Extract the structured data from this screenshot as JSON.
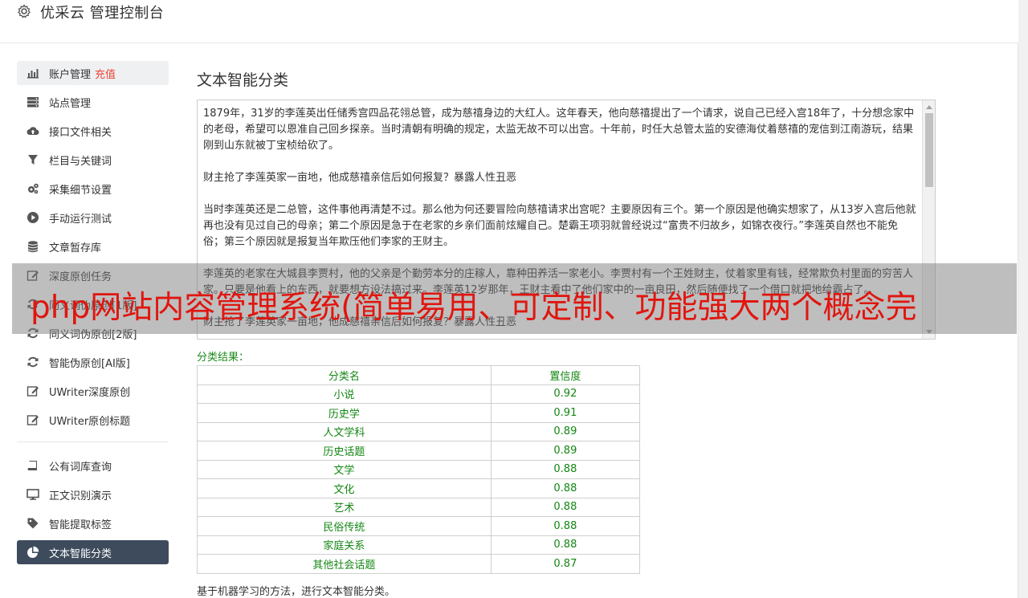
{
  "app": {
    "title": "优采云 管理控制台"
  },
  "sidebar": {
    "account": {
      "label": "账户管理",
      "recharge": "充值"
    },
    "items_group1": [
      {
        "label": "站点管理",
        "icon": "server-icon"
      },
      {
        "label": "接口文件相关",
        "icon": "cloud-upload-icon"
      },
      {
        "label": "栏目与关键词",
        "icon": "filter-icon"
      },
      {
        "label": "采集细节设置",
        "icon": "gears-icon"
      },
      {
        "label": "手动运行测试",
        "icon": "play-icon"
      },
      {
        "label": "文章暂存库",
        "icon": "database-icon"
      },
      {
        "label": "深度原创任务",
        "icon": "edit-icon"
      },
      {
        "label": "同义词伪原创[1版]",
        "icon": "refresh-icon"
      },
      {
        "label": "同义词伪原创[2版]",
        "icon": "refresh-icon"
      },
      {
        "label": "智能伪原创[AI版]",
        "icon": "refresh-icon"
      },
      {
        "label": "UWriter深度原创",
        "icon": "edit-icon"
      },
      {
        "label": "UWriter原创标题",
        "icon": "edit-icon"
      }
    ],
    "items_group2": [
      {
        "label": "公有词库查询",
        "icon": "book-icon"
      },
      {
        "label": "正文识别演示",
        "icon": "monitor-icon"
      },
      {
        "label": "智能提取标签",
        "icon": "tag-icon"
      },
      {
        "label": "文本智能分类",
        "icon": "pie-chart-icon"
      }
    ]
  },
  "main": {
    "title": "文本智能分类",
    "text_paragraphs": [
      "1879年，31岁的李莲英出任储秀宫四品花翎总管，成为慈禧身边的大红人。这年春天，他向慈禧提出了一个请求，说自己已经入宫18年了，十分想念家中的老母，希望可以恩准自己回乡探亲。当时清朝有明确的规定，太监无故不可以出宫。十年前，时任大总管太监的安德海仗着慈禧的宠信到江南游玩，结果刚到山东就被丁宝桢给砍了。",
      "财主抢了李莲英家一亩地，他成慈禧亲信后如何报复？暴露人性丑恶",
      "当时李莲英还是二总管，这件事他再清楚不过。那么他为何还要冒险向慈禧请求出宫呢？主要原因有三个。第一个原因是他确实想家了，从13岁入宫后他就再也没有见过自己的母亲；第二个原因是急于在老家的乡亲们面前炫耀自己。楚霸王项羽就曾经说过“富贵不归故乡，如锦衣夜行。”李莲英自然也不能免俗；第三个原因就是报复当年欺压他们李家的王财主。",
      "李莲英的老家在大城县李贾村，他的父亲是个勤劳本分的庄稼人，靠种田养活一家老小。李贾村有一个王姓财主，仗着家里有钱，经常欺负村里面的穷苦人家。只要是他看上的东西，就要想方设法搞过来。李莲英12岁那年，王财主看中了他们家中的一亩良田，然后随便找了一个借口就把地给霸占了。",
      "财主抢了李莲英家一亩地，他成慈禧亲信后如何报复？暴露人性丑恶"
    ],
    "result_label": "分类结果：",
    "table": {
      "headers": [
        "分类名",
        "置信度"
      ],
      "rows": [
        [
          "小说",
          "0.92"
        ],
        [
          "历史学",
          "0.91"
        ],
        [
          "人文学科",
          "0.89"
        ],
        [
          "历史话题",
          "0.89"
        ],
        [
          "文学",
          "0.88"
        ],
        [
          "文化",
          "0.88"
        ],
        [
          "艺术",
          "0.88"
        ],
        [
          "民俗传统",
          "0.88"
        ],
        [
          "家庭关系",
          "0.88"
        ],
        [
          "其他社会话题",
          "0.87"
        ]
      ]
    },
    "footnote": "基于机器学习的方法，进行文本智能分类。"
  },
  "watermark": {
    "text": "php网站内容管理系统(简单易用、可定制、功能强大两个概念完"
  },
  "colors": {
    "accent_red": "#e43",
    "result_green": "#138613",
    "selected_nav": "#3d4b5c",
    "watermark_red": "#e0160f"
  }
}
